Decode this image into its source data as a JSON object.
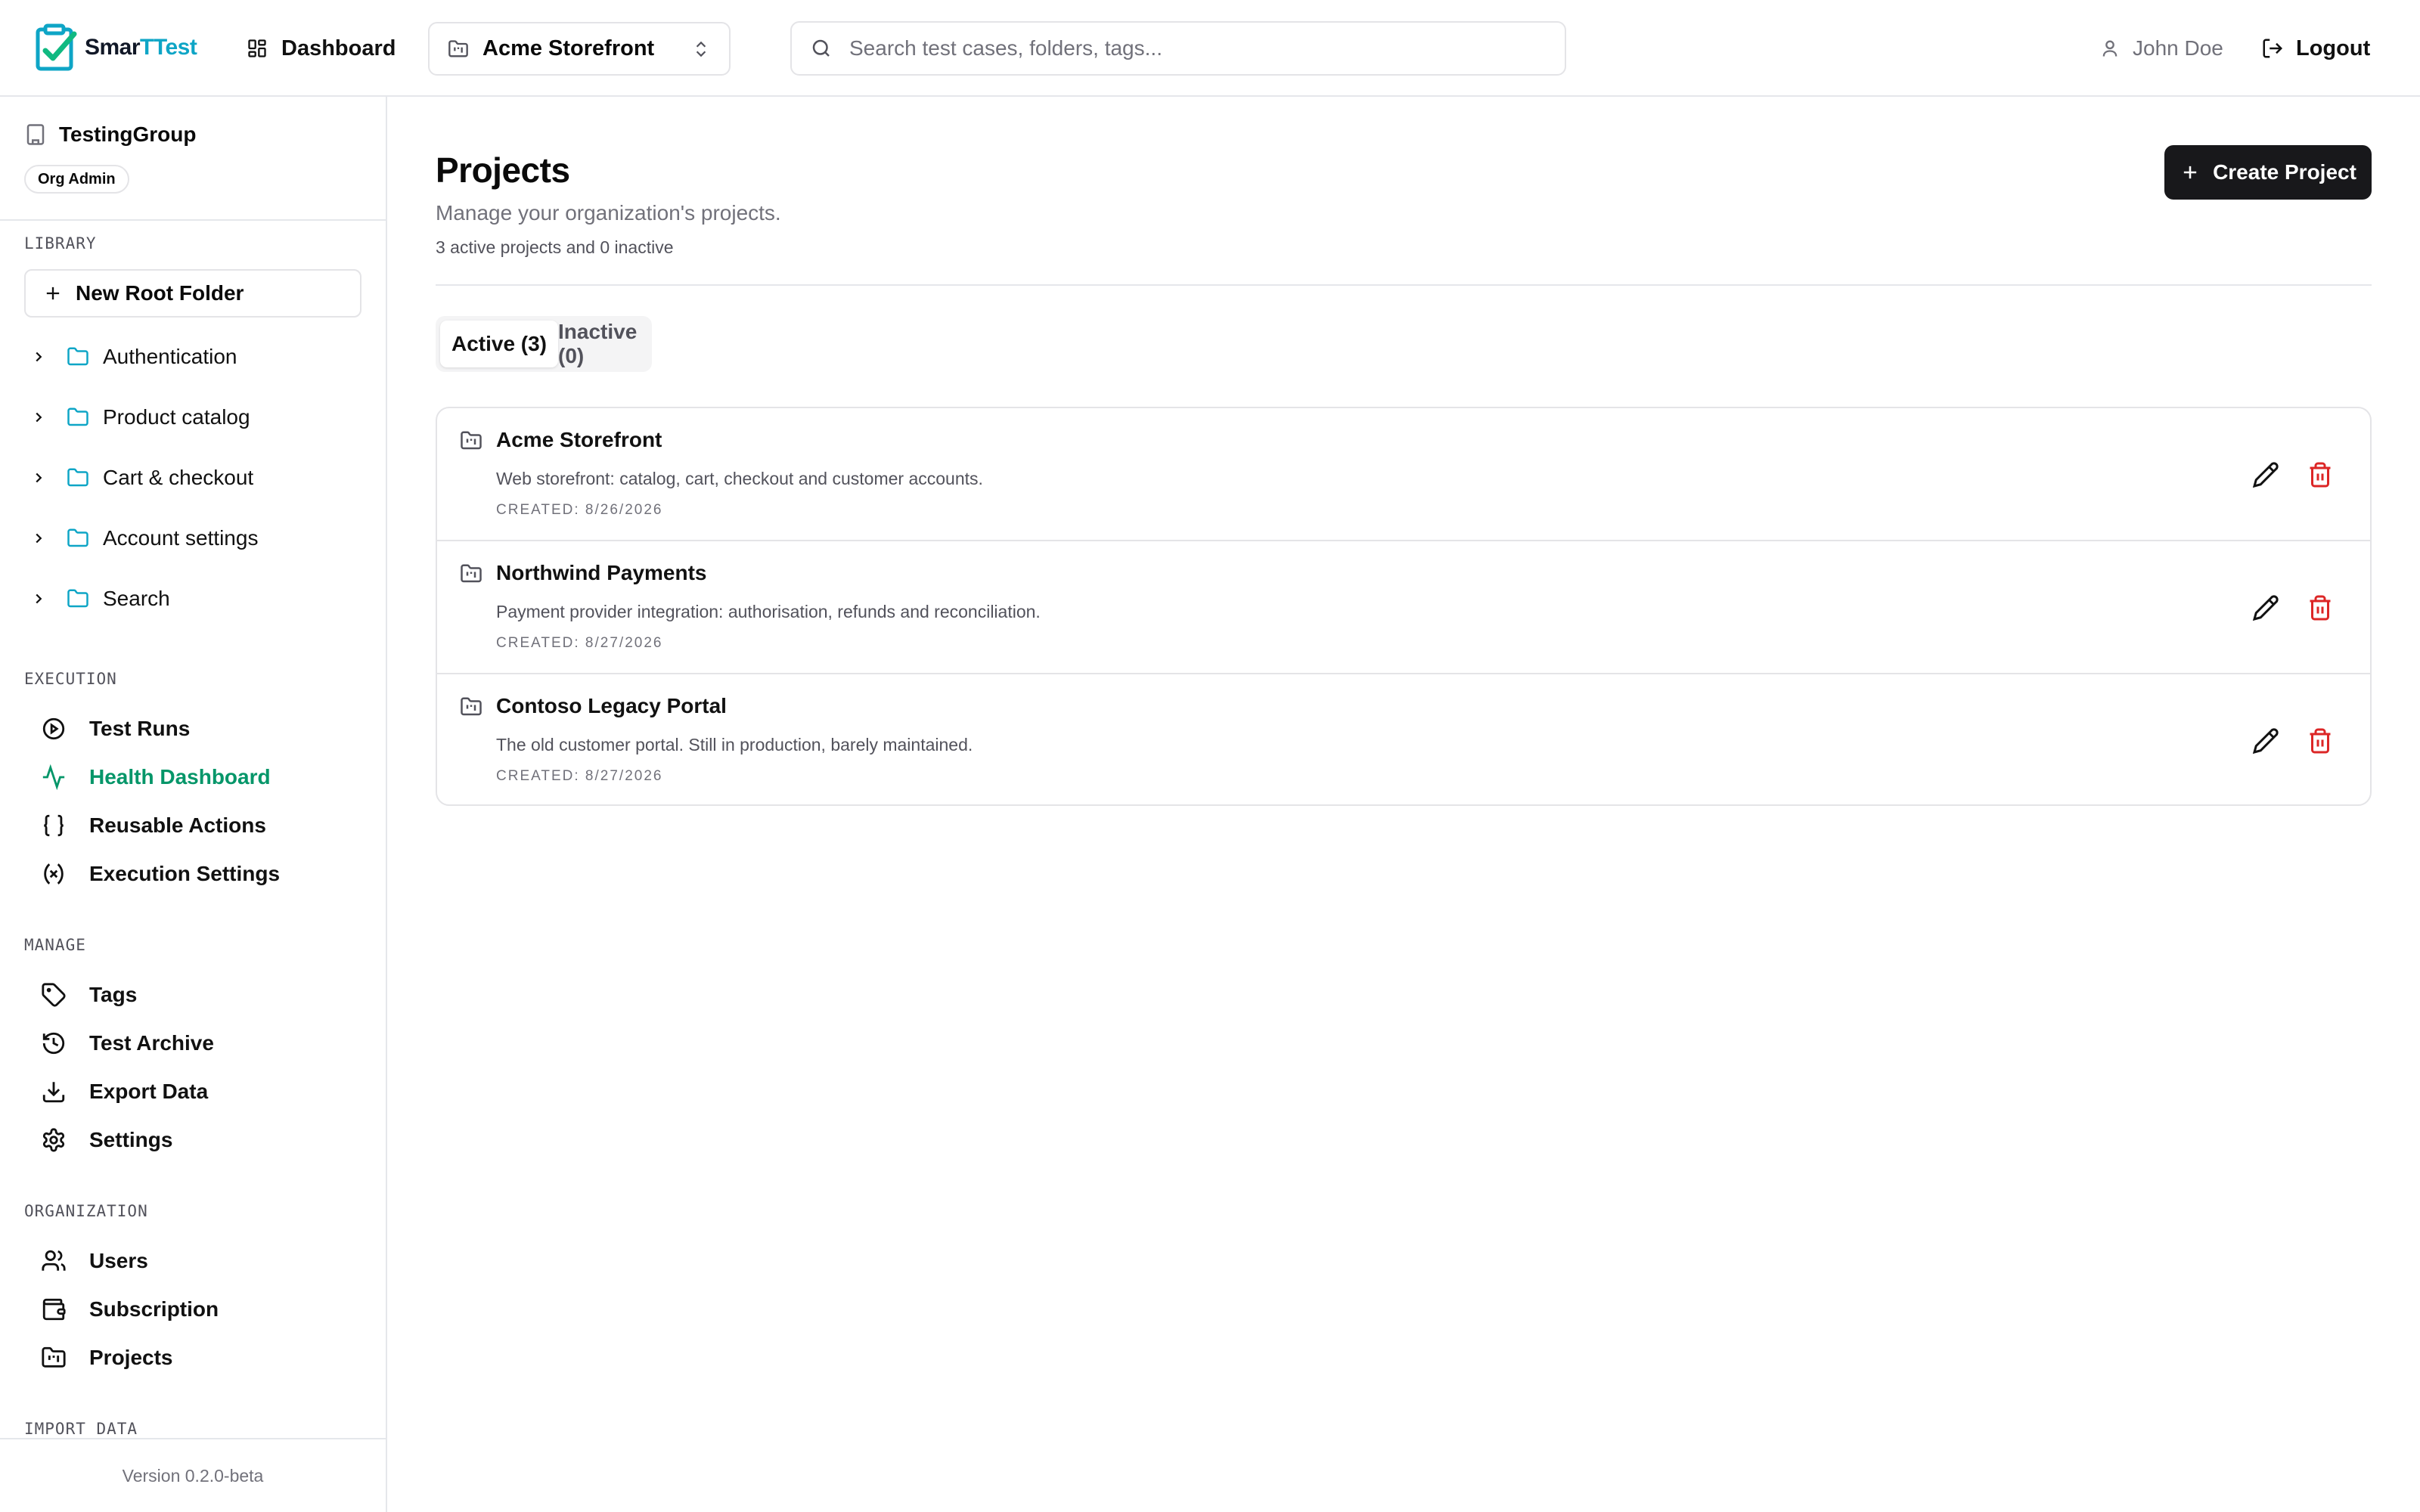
{
  "brand": {
    "name_part1": "Smar",
    "name_part2": "TTest",
    "accent": "#0ea5c6"
  },
  "header": {
    "dashboard_label": "Dashboard",
    "project_selector": "Acme Storefront",
    "search_placeholder": "Search test cases, folders, tags...",
    "user_name": "John Doe",
    "logout_label": "Logout"
  },
  "sidebar": {
    "org_name": "TestingGroup",
    "org_role": "Org Admin",
    "library_label": "LIBRARY",
    "new_root_folder": "New Root Folder",
    "folders": [
      {
        "label": "Authentication"
      },
      {
        "label": "Product catalog"
      },
      {
        "label": "Cart & checkout"
      },
      {
        "label": "Account settings"
      },
      {
        "label": "Search"
      }
    ],
    "execution_label": "EXECUTION",
    "execution_items": [
      {
        "label": "Test Runs",
        "icon": "play-circle-icon"
      },
      {
        "label": "Health Dashboard",
        "icon": "activity-icon",
        "active": true
      },
      {
        "label": "Reusable Actions",
        "icon": "braces-icon"
      },
      {
        "label": "Execution Settings",
        "icon": "variable-icon"
      }
    ],
    "manage_label": "MANAGE",
    "manage_items": [
      {
        "label": "Tags",
        "icon": "tag-icon"
      },
      {
        "label": "Test Archive",
        "icon": "history-icon"
      },
      {
        "label": "Export Data",
        "icon": "download-icon"
      },
      {
        "label": "Settings",
        "icon": "gear-icon"
      }
    ],
    "organization_label": "ORGANIZATION",
    "organization_items": [
      {
        "label": "Users",
        "icon": "users-icon"
      },
      {
        "label": "Subscription",
        "icon": "wallet-icon"
      },
      {
        "label": "Projects",
        "icon": "folder-kanban-icon"
      }
    ],
    "import_label": "IMPORT DATA",
    "version": "Version 0.2.0-beta"
  },
  "main": {
    "title": "Projects",
    "subtitle": "Manage your organization's projects.",
    "count_text": "3 active projects and 0 inactive",
    "create_button": "Create Project",
    "tabs": [
      {
        "label": "Active (3)",
        "selected": true
      },
      {
        "label": "Inactive (0)",
        "selected": false
      }
    ],
    "projects": [
      {
        "name": "Acme Storefront",
        "description": "Web storefront: catalog, cart, checkout and customer accounts.",
        "created": "CREATED: 8/26/2026"
      },
      {
        "name": "Northwind Payments",
        "description": "Payment provider integration: authorisation, refunds and reconciliation.",
        "created": "CREATED: 8/27/2026"
      },
      {
        "name": "Contoso Legacy Portal",
        "description": "The old customer portal. Still in production, barely maintained.",
        "created": "CREATED: 8/27/2026"
      }
    ]
  },
  "colors": {
    "active_nav": "#059669",
    "delete": "#dc2626",
    "primary_button": "#18181b"
  }
}
